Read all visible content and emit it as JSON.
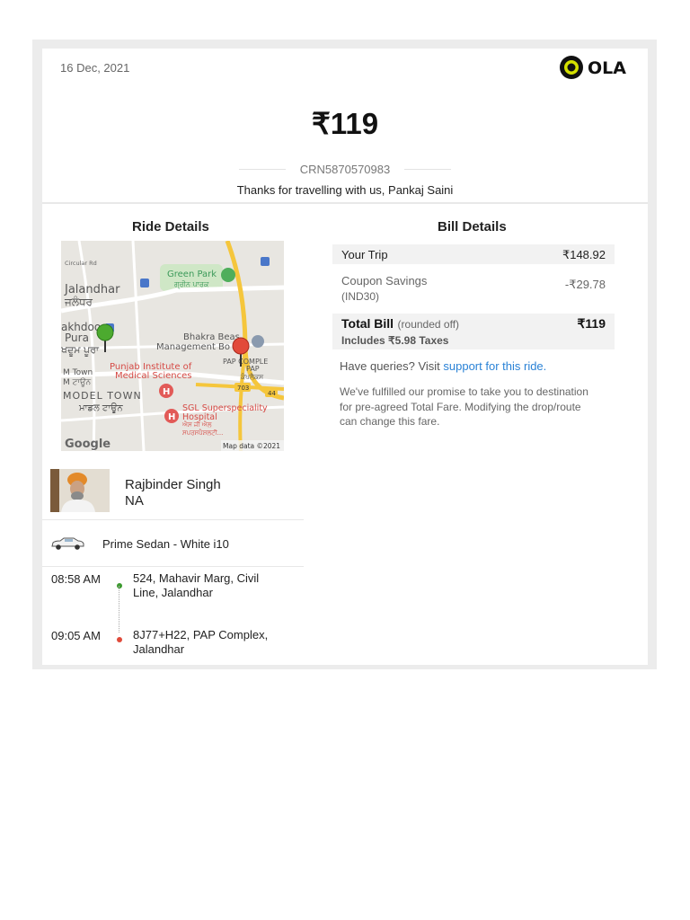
{
  "header": {
    "date": "16 Dec, 2021",
    "brand": "OLA",
    "amount": "₹119",
    "crn": "CRN5870570983",
    "thanks": "Thanks for travelling with us, Pankaj Saini"
  },
  "ride": {
    "title": "Ride Details",
    "map": {
      "labels": {
        "jalandhar": "Jalandhar",
        "jalandhar_pa": "ਜਲੰਧਰ",
        "green_park": "Green Park",
        "green_park_pa": "ਗ੍ਰੀਨ ਪਾਰਕ",
        "kakhdoo": "akhdoo",
        "pura": "Pura",
        "pura_pa": "ਖਦੂਮ ਪੂਰਾ",
        "bhakra": "Bhakra Beas",
        "mgmt": "Management Bo",
        "pap": "PAP COMPLE",
        "pap2": "PAP",
        "pap_pa": "ਕੰਪਲੈਕਸ",
        "pims1": "Punjab Institute of",
        "pims2": "Medical Sciences",
        "mtown": "M Town",
        "mtown_pa": "M ਟਾਊਨ",
        "model_town": "MODEL TOWN",
        "model_town_pa": "ਮਾਡਲ ਟਾਊਨ",
        "sgl1": "SGL Superspeciality",
        "sgl2": "Hospital",
        "sgl_pa1": "ਐਸ ਜੀ ਐਲ",
        "sgl_pa2": "ਸਪਰਸਪੈਸ਼ਲਟੀ...",
        "road_703": "703",
        "road_44": "44",
        "circular": "Circular Rd",
        "google": "Google",
        "map_data": "Map data ©2021"
      }
    },
    "driver": {
      "name": "Rajbinder Singh",
      "sub": "NA"
    },
    "vehicle": "Prime Sedan - White i10",
    "stops": [
      {
        "time": "08:58 AM",
        "address": "524, Mahavir Marg, Civil Line, Jalandhar"
      },
      {
        "time": "09:05 AM",
        "address": "8J77+H22, PAP Complex, Jalandhar"
      }
    ]
  },
  "bill": {
    "title": "Bill Details",
    "your_trip_label": "Your Trip",
    "your_trip_value": "₹148.92",
    "coupon_label": "Coupon Savings",
    "coupon_code": "(IND30)",
    "coupon_value": "-₹29.78",
    "total_label": "Total Bill",
    "total_note": "(rounded off)",
    "total_value": "₹119",
    "taxes": "Includes ₹5.98 Taxes",
    "queries_prefix": "Have queries? Visit",
    "queries_link": "support for this ride.",
    "note": "We've fulfilled our promise to take you to destination for pre-agreed Total Fare. Modifying the drop/route can change this fare."
  },
  "colors": {
    "brand_black": "#111111",
    "brand_yellow": "#d4e000",
    "link": "#2a82d6",
    "pickup_green": "#3c9a2f",
    "drop_red": "#e04a3a"
  }
}
